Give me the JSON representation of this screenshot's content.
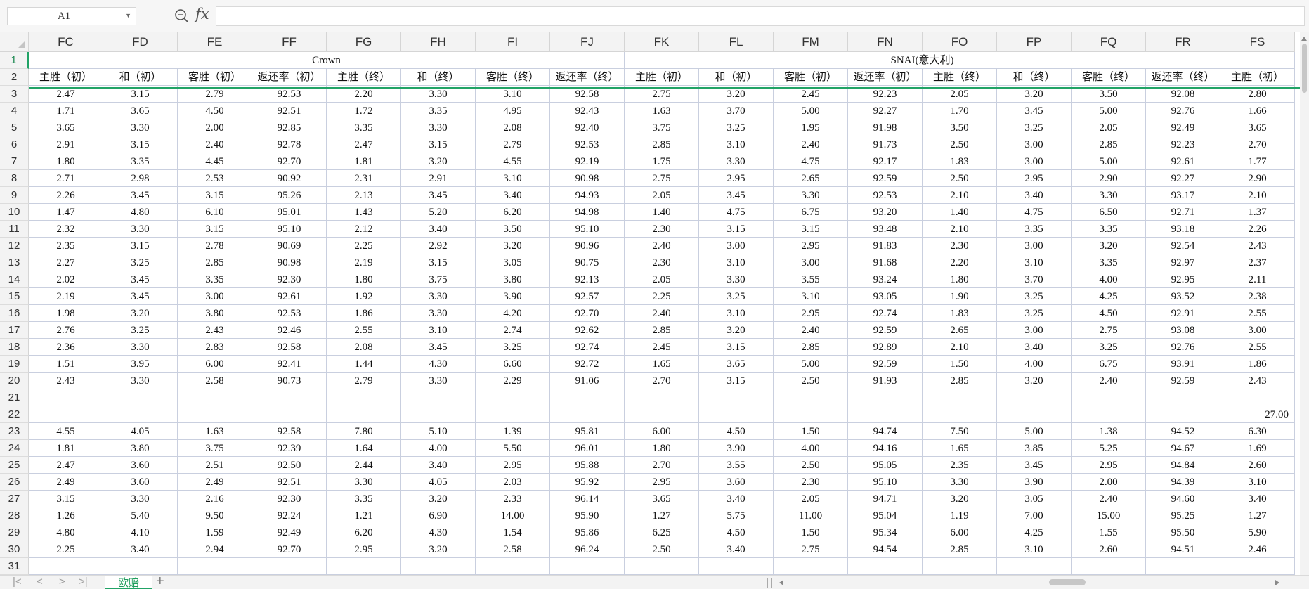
{
  "formula_bar": {
    "cell_ref": "A1",
    "fx_label": "fx",
    "formula_value": ""
  },
  "columns": [
    "FC",
    "FD",
    "FE",
    "FF",
    "FG",
    "FH",
    "FI",
    "FJ",
    "FK",
    "FL",
    "FM",
    "FN",
    "FO",
    "FP",
    "FQ",
    "FR",
    "FS"
  ],
  "selected_row": "1",
  "group_headers": [
    {
      "label": "Crown",
      "start": 0,
      "span": 8
    },
    {
      "label": "SNAI(意大利)",
      "start": 8,
      "span": 8
    },
    {
      "label": "",
      "start": 16,
      "span": 1
    }
  ],
  "sub_headers": [
    "主胜（初）",
    "和（初）",
    "客胜（初）",
    "返还率（初）",
    "主胜（终）",
    "和（终）",
    "客胜（终）",
    "返还率（终）",
    "主胜（初）",
    "和（初）",
    "客胜（初）",
    "返还率（初）",
    "主胜（终）",
    "和（终）",
    "客胜（终）",
    "返还率（终）",
    "主胜（初）"
  ],
  "data_rows": [
    {
      "row": "3",
      "cells": [
        "2.47",
        "3.15",
        "2.79",
        "92.53",
        "2.20",
        "3.30",
        "3.10",
        "92.58",
        "2.75",
        "3.20",
        "2.45",
        "92.23",
        "2.05",
        "3.20",
        "3.50",
        "92.08",
        "2.80"
      ]
    },
    {
      "row": "4",
      "cells": [
        "1.71",
        "3.65",
        "4.50",
        "92.51",
        "1.72",
        "3.35",
        "4.95",
        "92.43",
        "1.63",
        "3.70",
        "5.00",
        "92.27",
        "1.70",
        "3.45",
        "5.00",
        "92.76",
        "1.66"
      ]
    },
    {
      "row": "5",
      "cells": [
        "3.65",
        "3.30",
        "2.00",
        "92.85",
        "3.35",
        "3.30",
        "2.08",
        "92.40",
        "3.75",
        "3.25",
        "1.95",
        "91.98",
        "3.50",
        "3.25",
        "2.05",
        "92.49",
        "3.65"
      ]
    },
    {
      "row": "6",
      "cells": [
        "2.91",
        "3.15",
        "2.40",
        "92.78",
        "2.47",
        "3.15",
        "2.79",
        "92.53",
        "2.85",
        "3.10",
        "2.40",
        "91.73",
        "2.50",
        "3.00",
        "2.85",
        "92.23",
        "2.70"
      ]
    },
    {
      "row": "7",
      "cells": [
        "1.80",
        "3.35",
        "4.45",
        "92.70",
        "1.81",
        "3.20",
        "4.55",
        "92.19",
        "1.75",
        "3.30",
        "4.75",
        "92.17",
        "1.83",
        "3.00",
        "5.00",
        "92.61",
        "1.77"
      ]
    },
    {
      "row": "8",
      "cells": [
        "2.71",
        "2.98",
        "2.53",
        "90.92",
        "2.31",
        "2.91",
        "3.10",
        "90.98",
        "2.75",
        "2.95",
        "2.65",
        "92.59",
        "2.50",
        "2.95",
        "2.90",
        "92.27",
        "2.90"
      ]
    },
    {
      "row": "9",
      "cells": [
        "2.26",
        "3.45",
        "3.15",
        "95.26",
        "2.13",
        "3.45",
        "3.40",
        "94.93",
        "2.05",
        "3.45",
        "3.30",
        "92.53",
        "2.10",
        "3.40",
        "3.30",
        "93.17",
        "2.10"
      ]
    },
    {
      "row": "10",
      "cells": [
        "1.47",
        "4.80",
        "6.10",
        "95.01",
        "1.43",
        "5.20",
        "6.20",
        "94.98",
        "1.40",
        "4.75",
        "6.75",
        "93.20",
        "1.40",
        "4.75",
        "6.50",
        "92.71",
        "1.37"
      ]
    },
    {
      "row": "11",
      "cells": [
        "2.32",
        "3.30",
        "3.15",
        "95.10",
        "2.12",
        "3.40",
        "3.50",
        "95.10",
        "2.30",
        "3.15",
        "3.15",
        "93.48",
        "2.10",
        "3.35",
        "3.35",
        "93.18",
        "2.26"
      ]
    },
    {
      "row": "12",
      "cells": [
        "2.35",
        "3.15",
        "2.78",
        "90.69",
        "2.25",
        "2.92",
        "3.20",
        "90.96",
        "2.40",
        "3.00",
        "2.95",
        "91.83",
        "2.30",
        "3.00",
        "3.20",
        "92.54",
        "2.43"
      ]
    },
    {
      "row": "13",
      "cells": [
        "2.27",
        "3.25",
        "2.85",
        "90.98",
        "2.19",
        "3.15",
        "3.05",
        "90.75",
        "2.30",
        "3.10",
        "3.00",
        "91.68",
        "2.20",
        "3.10",
        "3.35",
        "92.97",
        "2.37"
      ]
    },
    {
      "row": "14",
      "cells": [
        "2.02",
        "3.45",
        "3.35",
        "92.30",
        "1.80",
        "3.75",
        "3.80",
        "92.13",
        "2.05",
        "3.30",
        "3.55",
        "93.24",
        "1.80",
        "3.70",
        "4.00",
        "92.95",
        "2.11"
      ]
    },
    {
      "row": "15",
      "cells": [
        "2.19",
        "3.45",
        "3.00",
        "92.61",
        "1.92",
        "3.30",
        "3.90",
        "92.57",
        "2.25",
        "3.25",
        "3.10",
        "93.05",
        "1.90",
        "3.25",
        "4.25",
        "93.52",
        "2.38"
      ]
    },
    {
      "row": "16",
      "cells": [
        "1.98",
        "3.20",
        "3.80",
        "92.53",
        "1.86",
        "3.30",
        "4.20",
        "92.70",
        "2.40",
        "3.10",
        "2.95",
        "92.74",
        "1.83",
        "3.25",
        "4.50",
        "92.91",
        "2.55"
      ]
    },
    {
      "row": "17",
      "cells": [
        "2.76",
        "3.25",
        "2.43",
        "92.46",
        "2.55",
        "3.10",
        "2.74",
        "92.62",
        "2.85",
        "3.20",
        "2.40",
        "92.59",
        "2.65",
        "3.00",
        "2.75",
        "93.08",
        "3.00"
      ]
    },
    {
      "row": "18",
      "cells": [
        "2.36",
        "3.30",
        "2.83",
        "92.58",
        "2.08",
        "3.45",
        "3.25",
        "92.74",
        "2.45",
        "3.15",
        "2.85",
        "92.89",
        "2.10",
        "3.40",
        "3.25",
        "92.76",
        "2.55"
      ]
    },
    {
      "row": "19",
      "cells": [
        "1.51",
        "3.95",
        "6.00",
        "92.41",
        "1.44",
        "4.30",
        "6.60",
        "92.72",
        "1.65",
        "3.65",
        "5.00",
        "92.59",
        "1.50",
        "4.00",
        "6.75",
        "93.91",
        "1.86"
      ]
    },
    {
      "row": "20",
      "cells": [
        "2.43",
        "3.30",
        "2.58",
        "90.73",
        "2.79",
        "3.30",
        "2.29",
        "91.06",
        "2.70",
        "3.15",
        "2.50",
        "91.93",
        "2.85",
        "3.20",
        "2.40",
        "92.59",
        "2.43"
      ]
    },
    {
      "row": "21",
      "cells": [
        "",
        "",
        "",
        "",
        "",
        "",
        "",
        "",
        "",
        "",
        "",
        "",
        "",
        "",
        "",
        "",
        ""
      ]
    },
    {
      "row": "22",
      "cells": [
        "",
        "",
        "",
        "",
        "",
        "",
        "",
        "",
        "",
        "",
        "",
        "",
        "",
        "",
        "",
        "",
        "27.00"
      ]
    },
    {
      "row": "23",
      "cells": [
        "4.55",
        "4.05",
        "1.63",
        "92.58",
        "7.80",
        "5.10",
        "1.39",
        "95.81",
        "6.00",
        "4.50",
        "1.50",
        "94.74",
        "7.50",
        "5.00",
        "1.38",
        "94.52",
        "6.30"
      ]
    },
    {
      "row": "24",
      "cells": [
        "1.81",
        "3.80",
        "3.75",
        "92.39",
        "1.64",
        "4.00",
        "5.50",
        "96.01",
        "1.80",
        "3.90",
        "4.00",
        "94.16",
        "1.65",
        "3.85",
        "5.25",
        "94.67",
        "1.69"
      ]
    },
    {
      "row": "25",
      "cells": [
        "2.47",
        "3.60",
        "2.51",
        "92.50",
        "2.44",
        "3.40",
        "2.95",
        "95.88",
        "2.70",
        "3.55",
        "2.50",
        "95.05",
        "2.35",
        "3.45",
        "2.95",
        "94.84",
        "2.60"
      ]
    },
    {
      "row": "26",
      "cells": [
        "2.49",
        "3.60",
        "2.49",
        "92.51",
        "3.30",
        "4.05",
        "2.03",
        "95.92",
        "2.95",
        "3.60",
        "2.30",
        "95.10",
        "3.30",
        "3.90",
        "2.00",
        "94.39",
        "3.10"
      ]
    },
    {
      "row": "27",
      "cells": [
        "3.15",
        "3.30",
        "2.16",
        "92.30",
        "3.35",
        "3.20",
        "2.33",
        "96.14",
        "3.65",
        "3.40",
        "2.05",
        "94.71",
        "3.20",
        "3.05",
        "2.40",
        "94.60",
        "3.40"
      ]
    },
    {
      "row": "28",
      "cells": [
        "1.26",
        "5.40",
        "9.50",
        "92.24",
        "1.21",
        "6.90",
        "14.00",
        "95.90",
        "1.27",
        "5.75",
        "11.00",
        "95.04",
        "1.19",
        "7.00",
        "15.00",
        "95.25",
        "1.27"
      ]
    },
    {
      "row": "29",
      "cells": [
        "4.80",
        "4.10",
        "1.59",
        "92.49",
        "6.20",
        "4.30",
        "1.54",
        "95.86",
        "6.25",
        "4.50",
        "1.50",
        "95.34",
        "6.00",
        "4.25",
        "1.55",
        "95.50",
        "5.90"
      ]
    },
    {
      "row": "30",
      "cells": [
        "2.25",
        "3.40",
        "2.94",
        "92.70",
        "2.95",
        "3.20",
        "2.58",
        "96.24",
        "2.50",
        "3.40",
        "2.75",
        "94.54",
        "2.85",
        "3.10",
        "2.60",
        "94.51",
        "2.46"
      ]
    },
    {
      "row": "31",
      "cells": [
        "",
        "",
        "",
        "",
        "",
        "",
        "",
        "",
        "",
        "",
        "",
        "",
        "",
        "",
        "",
        "",
        ""
      ]
    }
  ],
  "sheet_tabs": [
    {
      "label": "欧赔",
      "active": true
    }
  ],
  "nav": {
    "first": "|<",
    "prev": "<",
    "next": ">",
    "last": ">|",
    "add": "+"
  },
  "colors": {
    "accent": "#21a366",
    "grid_line": "#c9cfdf",
    "header_bg": "#f3f3f3"
  }
}
